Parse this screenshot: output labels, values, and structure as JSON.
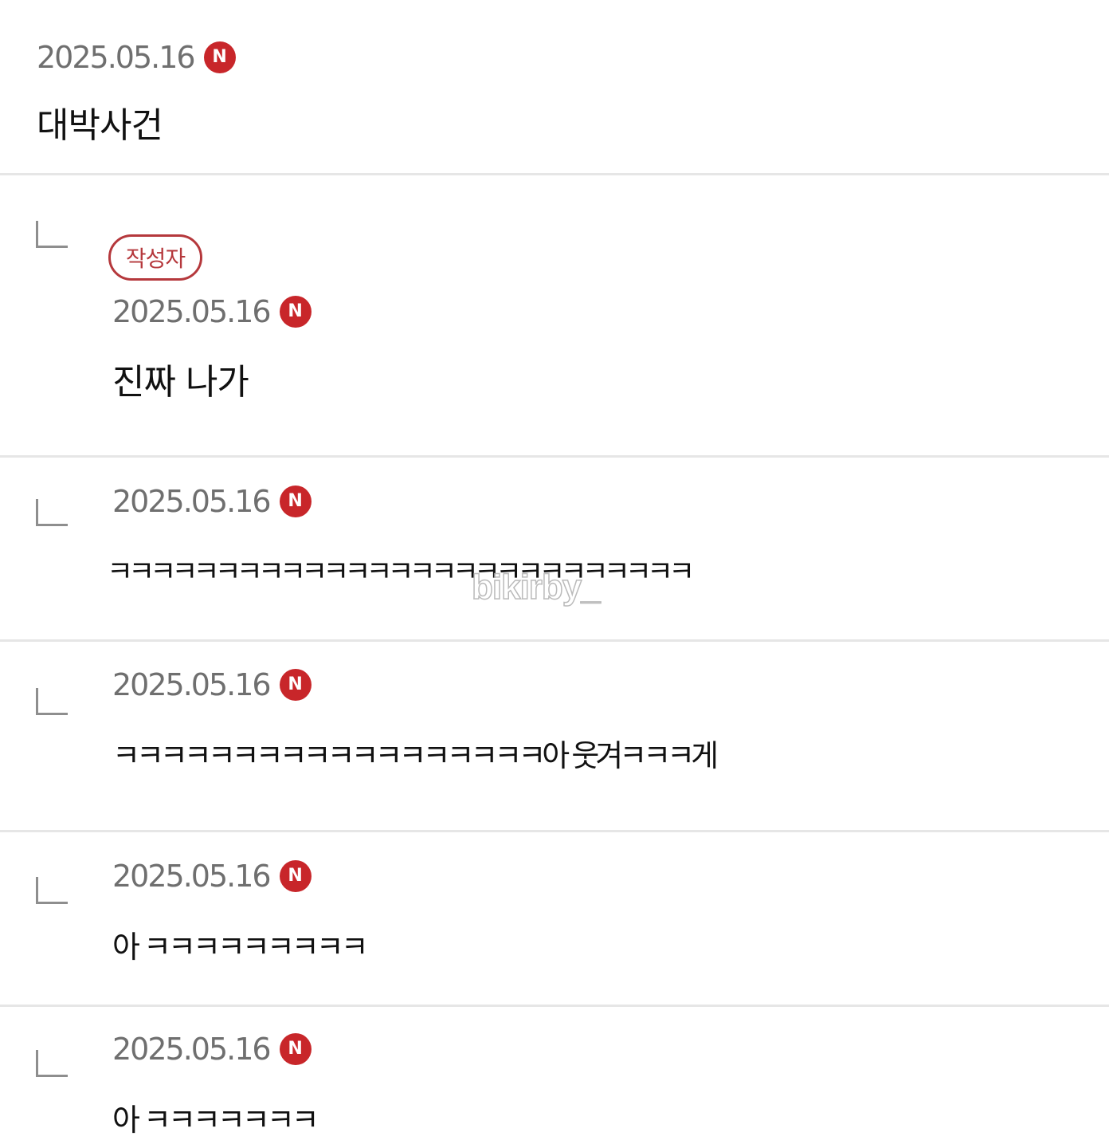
{
  "post": {
    "date": "2025.05.16",
    "new_badge": "N",
    "text": "대박사건"
  },
  "replies": [
    {
      "author_tag": "작성자",
      "date": "2025.05.16",
      "new_badge": "N",
      "text": "진짜 나가"
    },
    {
      "date": "2025.05.16",
      "new_badge": "N",
      "text": "ㅋㅋㅋㅋㅋㅋㅋㅋㅋㅋㅋㅋㅋㅋㅋㅋㅋㅋㅋㅋㅋㅋㅋㅋㅋㅋㅋ"
    },
    {
      "date": "2025.05.16",
      "new_badge": "N",
      "text": "ㅋㅋㅋㅋㅋㅋㅋㅋㅋㅋㅋㅋㅋㅋㅋㅋㅋㅋ아 웃겨ㅋㅋㅋ게"
    },
    {
      "date": "2025.05.16",
      "new_badge": "N",
      "text": "아 ㅋㅋㅋㅋㅋㅋㅋㅋㅋ"
    },
    {
      "date": "2025.05.16",
      "new_badge": "N",
      "text": "아 ㅋㅋㅋㅋㅋㅋㅋ"
    }
  ],
  "watermark": "bikirby_",
  "colors": {
    "badge_red": "#c8262a",
    "author_tag_red": "#b5383c",
    "date_gray": "#6f6f6f",
    "divider": "#e6e6e6"
  },
  "icons": {
    "new_badge": "new-badge-icon",
    "reply": "reply-arrow-icon"
  }
}
